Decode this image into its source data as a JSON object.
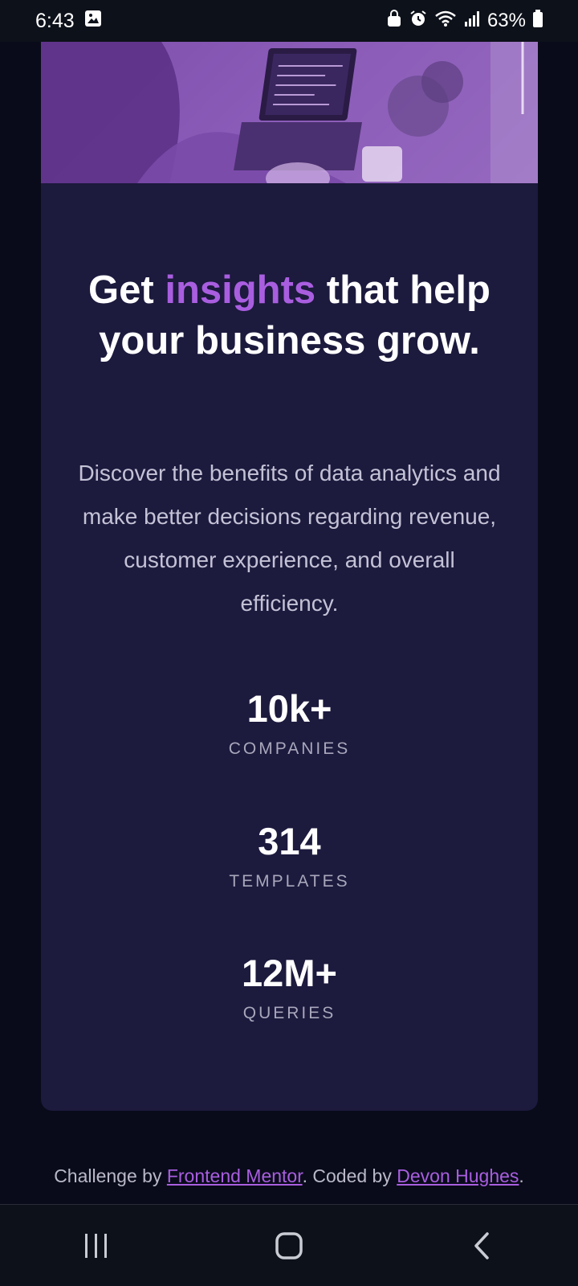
{
  "status_bar": {
    "time": "6:43",
    "battery": "63%",
    "icons": [
      "image-icon",
      "lock-icon",
      "alarm-icon",
      "wifi-icon",
      "signal-icon",
      "battery-icon"
    ]
  },
  "card": {
    "headline_pre": "Get ",
    "headline_accent": "insights",
    "headline_post": " that help your business grow.",
    "description": "Discover the benefits of data analytics and make better decisions regarding revenue, customer experience, and overall efficiency.",
    "stats": [
      {
        "value": "10k+",
        "label": "COMPANIES"
      },
      {
        "value": "314",
        "label": "TEMPLATES"
      },
      {
        "value": "12M+",
        "label": "QUERIES"
      }
    ]
  },
  "footer": {
    "prefix": "Challenge by ",
    "link1": "Frontend Mentor",
    "middle": ". Coded by ",
    "link2": "Devon Hughes",
    "suffix": "."
  },
  "colors": {
    "background": "#090b1a",
    "card": "#1c1a3d",
    "accent": "#a95ee0",
    "hero_tint": "#8a5bb8"
  },
  "nav_bar": {
    "icons": [
      "recent-apps-icon",
      "home-icon",
      "back-icon"
    ]
  }
}
